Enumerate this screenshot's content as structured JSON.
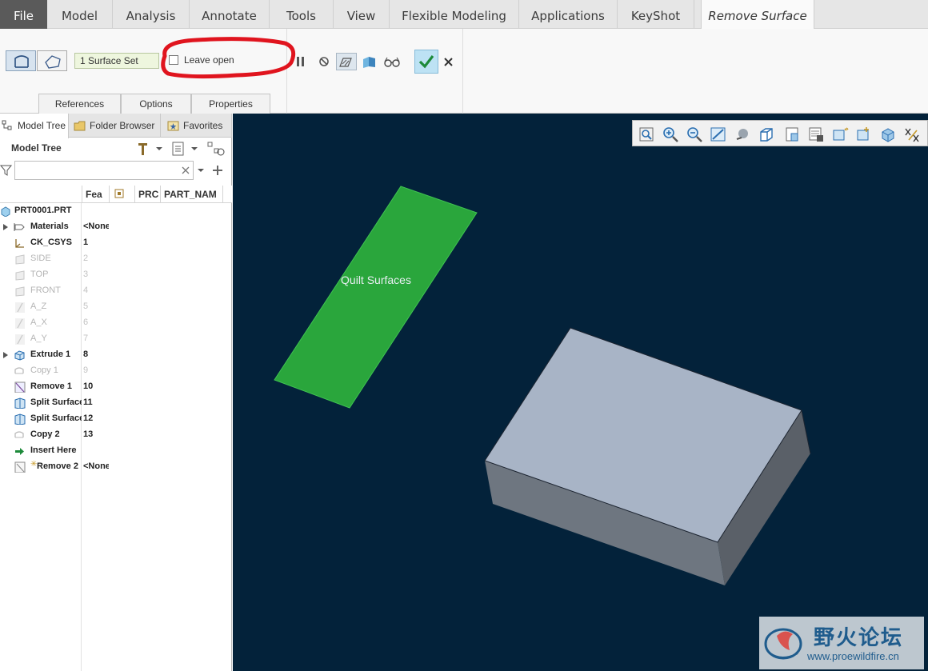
{
  "ribbon": {
    "tabs": [
      {
        "label": "File"
      },
      {
        "label": "Model"
      },
      {
        "label": "Analysis"
      },
      {
        "label": "Annotate"
      },
      {
        "label": "Tools"
      },
      {
        "label": "View"
      },
      {
        "label": "Flexible Modeling"
      },
      {
        "label": "Applications"
      },
      {
        "label": "KeyShot"
      },
      {
        "label": "Remove Surface"
      }
    ],
    "active_tab": "Remove Surface"
  },
  "dashboard": {
    "collector_value": "1 Surface Set",
    "leave_open_label": "Leave open",
    "leave_open_checked": false,
    "subtabs": [
      "References",
      "Options",
      "Properties"
    ]
  },
  "panel": {
    "tabs": [
      "Model Tree",
      "Folder Browser",
      "Favorites"
    ],
    "title": "Model Tree",
    "search_value": "",
    "columns": [
      "Fea",
      "",
      "PRC",
      "PART_NAM"
    ],
    "root": "PRT0001.PRT",
    "items": [
      {
        "name": "Materials",
        "num": "<None",
        "dim": false,
        "expand": true,
        "icon": "materials-icon"
      },
      {
        "name": "CK_CSYS",
        "num": "1",
        "dim": false,
        "expand": false,
        "icon": "csys-icon"
      },
      {
        "name": "SIDE",
        "num": "2",
        "dim": true,
        "expand": false,
        "icon": "datum-plane-icon"
      },
      {
        "name": "TOP",
        "num": "3",
        "dim": true,
        "expand": false,
        "icon": "datum-plane-icon"
      },
      {
        "name": "FRONT",
        "num": "4",
        "dim": true,
        "expand": false,
        "icon": "datum-plane-icon"
      },
      {
        "name": "A_Z",
        "num": "5",
        "dim": true,
        "expand": false,
        "icon": "datum-axis-icon"
      },
      {
        "name": "A_X",
        "num": "6",
        "dim": true,
        "expand": false,
        "icon": "datum-axis-icon"
      },
      {
        "name": "A_Y",
        "num": "7",
        "dim": true,
        "expand": false,
        "icon": "datum-axis-icon"
      },
      {
        "name": "Extrude 1",
        "num": "8",
        "dim": false,
        "expand": true,
        "icon": "extrude-icon"
      },
      {
        "name": "Copy 1",
        "num": "9",
        "dim": true,
        "expand": false,
        "icon": "copy-icon"
      },
      {
        "name": "Remove 1",
        "num": "10",
        "dim": false,
        "expand": false,
        "icon": "remove-icon"
      },
      {
        "name": "Split Surface",
        "num": "11",
        "dim": false,
        "expand": false,
        "icon": "split-surface-icon"
      },
      {
        "name": "Split Surface",
        "num": "12",
        "dim": false,
        "expand": false,
        "icon": "split-surface-icon"
      },
      {
        "name": "Copy 2",
        "num": "13",
        "dim": false,
        "expand": false,
        "icon": "copy-icon"
      },
      {
        "name": "Insert Here",
        "num": "",
        "dim": false,
        "expand": false,
        "icon": "insert-arrow-icon"
      },
      {
        "name": "Remove 2",
        "num": "<None",
        "dim": false,
        "expand": false,
        "icon": "remove-new-icon"
      }
    ]
  },
  "graphics": {
    "surface_label": "Quilt Surfaces",
    "background": "#03223a",
    "quilt_color": "#2aa63c",
    "block_top": "#a8b4c6",
    "block_front": "#6e7680",
    "block_right": "#5a6068"
  },
  "watermark": {
    "title": "野火论坛",
    "url": "www.proewildfire.cn"
  },
  "colors": {
    "annotation_red": "#e0141e",
    "ok_button": "#bde2f4"
  }
}
